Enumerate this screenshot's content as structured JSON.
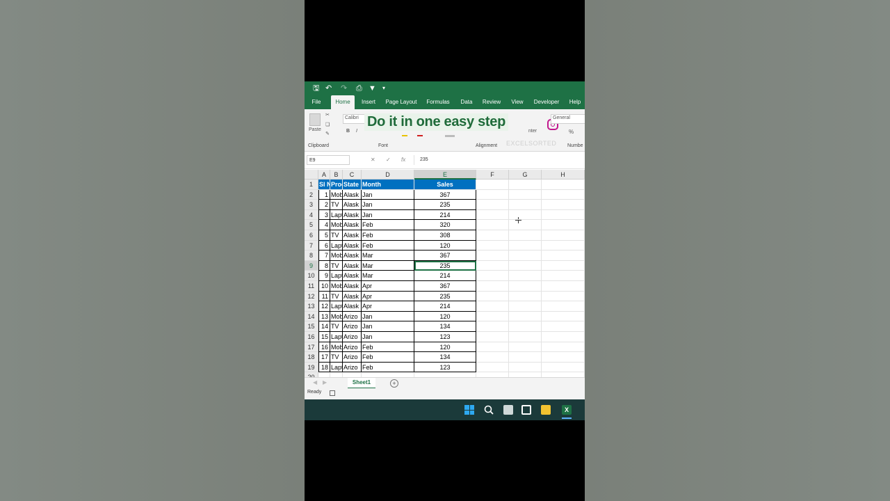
{
  "colors": {
    "excel_green": "#1e7145",
    "header_blue": "#0070c0",
    "overlay_green": "#1f6b3a"
  },
  "ribbon_tabs": [
    "File",
    "Home",
    "Insert",
    "Page Layout",
    "Formulas",
    "Data",
    "Review",
    "View",
    "Developer",
    "Help"
  ],
  "ribbon": {
    "paste_label": "Paste",
    "font_name": "Calibri",
    "number_format": "General",
    "merge_label": "nter",
    "percent": "%",
    "groups": {
      "clipboard": "Clipboard",
      "font": "Font",
      "alignment": "Alignment",
      "number": "Numbe"
    },
    "overlay": "Do it in one easy step",
    "watermark": "EXCELSORTED"
  },
  "formula_bar": {
    "name_box": "E9",
    "fx": "fx",
    "value": "235"
  },
  "columns": [
    "A",
    "B",
    "C",
    "D",
    "E",
    "F",
    "G",
    "H"
  ],
  "table": {
    "headers": [
      "Sl No",
      "Produ",
      "State",
      "Month",
      "Sales"
    ],
    "rows": [
      [
        "1",
        "Mobil",
        "Alask",
        "Jan",
        "367"
      ],
      [
        "2",
        "TV",
        "Alask",
        "Jan",
        "235"
      ],
      [
        "3",
        "Lapto",
        "Alask",
        "Jan",
        "214"
      ],
      [
        "4",
        "Mobil",
        "Alask",
        "Feb",
        "320"
      ],
      [
        "5",
        "TV",
        "Alask",
        "Feb",
        "308"
      ],
      [
        "6",
        "Lapto",
        "Alask",
        "Feb",
        "120"
      ],
      [
        "7",
        "Mobil",
        "Alask",
        "Mar",
        "367"
      ],
      [
        "8",
        "TV",
        "Alask",
        "Mar",
        "235"
      ],
      [
        "9",
        "Lapto",
        "Alask",
        "Mar",
        "214"
      ],
      [
        "10",
        "Mobil",
        "Alask",
        "Apr",
        "367"
      ],
      [
        "11",
        "TV",
        "Alask",
        "Apr",
        "235"
      ],
      [
        "12",
        "Lapto",
        "Alask",
        "Apr",
        "214"
      ],
      [
        "13",
        "Mobil",
        "Arizo",
        "Jan",
        "120"
      ],
      [
        "14",
        "TV",
        "Arizo",
        "Jan",
        "134"
      ],
      [
        "15",
        "Lapto",
        "Arizo",
        "Jan",
        "123"
      ],
      [
        "16",
        "Mobil",
        "Arizo",
        "Feb",
        "120"
      ],
      [
        "17",
        "TV",
        "Arizo",
        "Feb",
        "134"
      ],
      [
        "18",
        "Lapto",
        "Arizo",
        "Feb",
        "123"
      ]
    ]
  },
  "sheet_tab": "Sheet1",
  "add_sheet": "+",
  "status": "Ready"
}
